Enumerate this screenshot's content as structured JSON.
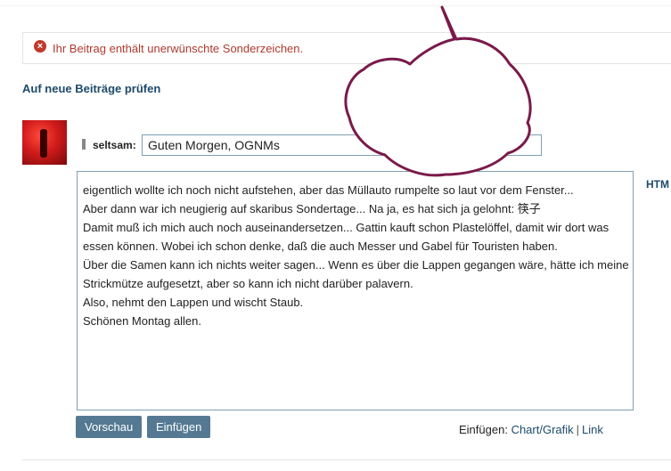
{
  "error": {
    "icon": "error-circle-icon",
    "message": "Ihr Beitrag enthält unerwünschte Sonderzeichen."
  },
  "check_new_posts_link": "Auf neue Beiträge prüfen",
  "post": {
    "user_label": "seltsam:",
    "title_value": "Guten Morgen, OGNMs",
    "body_lines": [
      "eigentlich wollte ich noch nicht aufstehen, aber das Müllauto rumpelte so laut vor dem Fenster...",
      "Aber dann war ich neugierig auf skaribus Sondertage... Na ja, es hat sich ja gelohnt: 筷子",
      "Damit muß ich mich auch noch auseinandersetzen... Gattin kauft schon Plastelöffel, damit wir dort was",
      "essen können. Wobei ich schon denke, daß die auch Messer und Gabel für Touristen haben.",
      "Über die Samen kann ich nichts weiter sagen... Wenn es über die Lappen gegangen wäre, hätte ich meine",
      "Strickmütze aufgesetzt, aber so kann ich nicht darüber palavern.",
      "Also, nehmt den Lappen und wischt Staub.",
      "Schönen Montag allen."
    ],
    "side_label": "HTM"
  },
  "buttons": {
    "preview": "Vorschau",
    "insert": "Einfügen"
  },
  "insert_row": {
    "label": "Einfügen:",
    "chart_link": "Chart/Grafik",
    "separator": "|",
    "link_link": "Link"
  },
  "colors": {
    "button_bg": "#557992",
    "link": "#1d4a6b",
    "error": "#b03a2e",
    "bubble_stroke": "#7a1a4a"
  }
}
